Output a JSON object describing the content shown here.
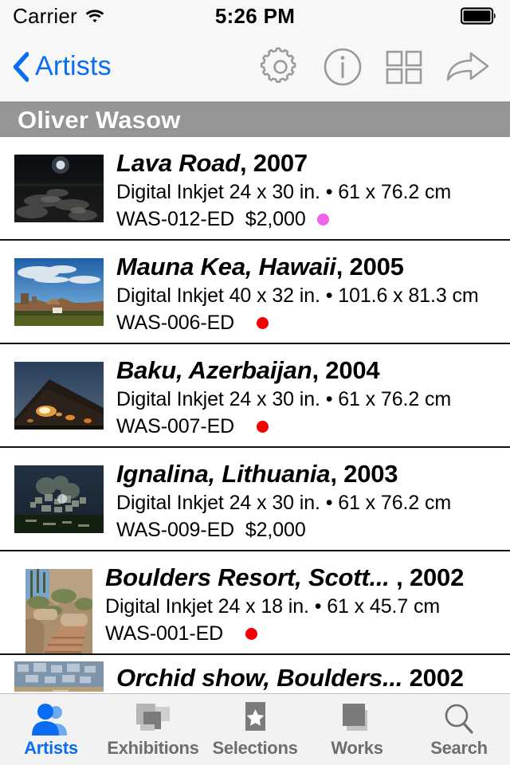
{
  "status_bar": {
    "carrier": "Carrier",
    "wifi_icon": "wifi-icon",
    "time": "5:26 PM",
    "battery_icon": "battery-full-icon"
  },
  "nav_bar": {
    "back_label": "Artists",
    "back_icon": "chevron-left-icon",
    "actions": [
      {
        "name": "settings-icon",
        "label": "Settings"
      },
      {
        "name": "info-icon",
        "label": "Info"
      },
      {
        "name": "grid-icon",
        "label": "Grid View"
      },
      {
        "name": "share-icon",
        "label": "Share"
      }
    ]
  },
  "section": {
    "header_title": "Oliver Wasow",
    "header_bg": "#969696"
  },
  "colors": {
    "accent_blue": "#0a6cf0",
    "dot_magenta": "#f060e8",
    "dot_red": "#f00000"
  },
  "works": [
    {
      "title": "Lava Road",
      "year": ", 2007",
      "medium": "Digital Inkjet  24 x 30 in. •  61 x 76.2 cm",
      "code": "WAS-012-ED  $2,000",
      "dot": "#f060e8",
      "thumb": "lava-road-thumbnail",
      "orientation": "landscape"
    },
    {
      "title": "Mauna Kea, Hawaii",
      "year": ", 2005",
      "medium": "Digital Inkjet  40 x 32 in. •  101.6 x 81.3 cm",
      "code": "WAS-006-ED  ",
      "dot": "#f00000",
      "thumb": "mauna-kea-thumbnail",
      "orientation": "landscape"
    },
    {
      "title": "Baku, Azerbaijan",
      "year": ", 2004",
      "medium": "Digital Inkjet  24 x 30 in. •  61 x 76.2 cm",
      "code": "WAS-007-ED  ",
      "dot": "#f00000",
      "thumb": "baku-thumbnail",
      "orientation": "landscape"
    },
    {
      "title": "Ignalina, Lithuania",
      "year": ", 2003",
      "medium": "Digital Inkjet  24 x 30 in. •  61 x 76.2 cm",
      "code": "WAS-009-ED  $2,000",
      "dot": "",
      "thumb": "ignalina-thumbnail",
      "orientation": "landscape"
    },
    {
      "title": "Boulders Resort, Scott...",
      "year": " , 2002",
      "medium": "Digital Inkjet  24 x 18 in. •  61 x 45.7 cm",
      "code": "WAS-001-ED  ",
      "dot": "#f00000",
      "thumb": "boulders-resort-thumbnail",
      "orientation": "portrait"
    },
    {
      "title": "Orchid show, Boulders...",
      "year": "  2002",
      "medium": "",
      "code": "",
      "dot": "",
      "thumb": "orchid-show-thumbnail",
      "orientation": "landscape"
    }
  ],
  "tab_bar": {
    "tabs": [
      {
        "label": "Artists",
        "icon": "people-icon",
        "active": true
      },
      {
        "label": "Exhibitions",
        "icon": "frames-icon",
        "active": false
      },
      {
        "label": "Selections",
        "icon": "star-card-icon",
        "active": false
      },
      {
        "label": "Works",
        "icon": "stacked-squares-icon",
        "active": false
      },
      {
        "label": "Search",
        "icon": "magnifier-icon",
        "active": false
      }
    ]
  }
}
